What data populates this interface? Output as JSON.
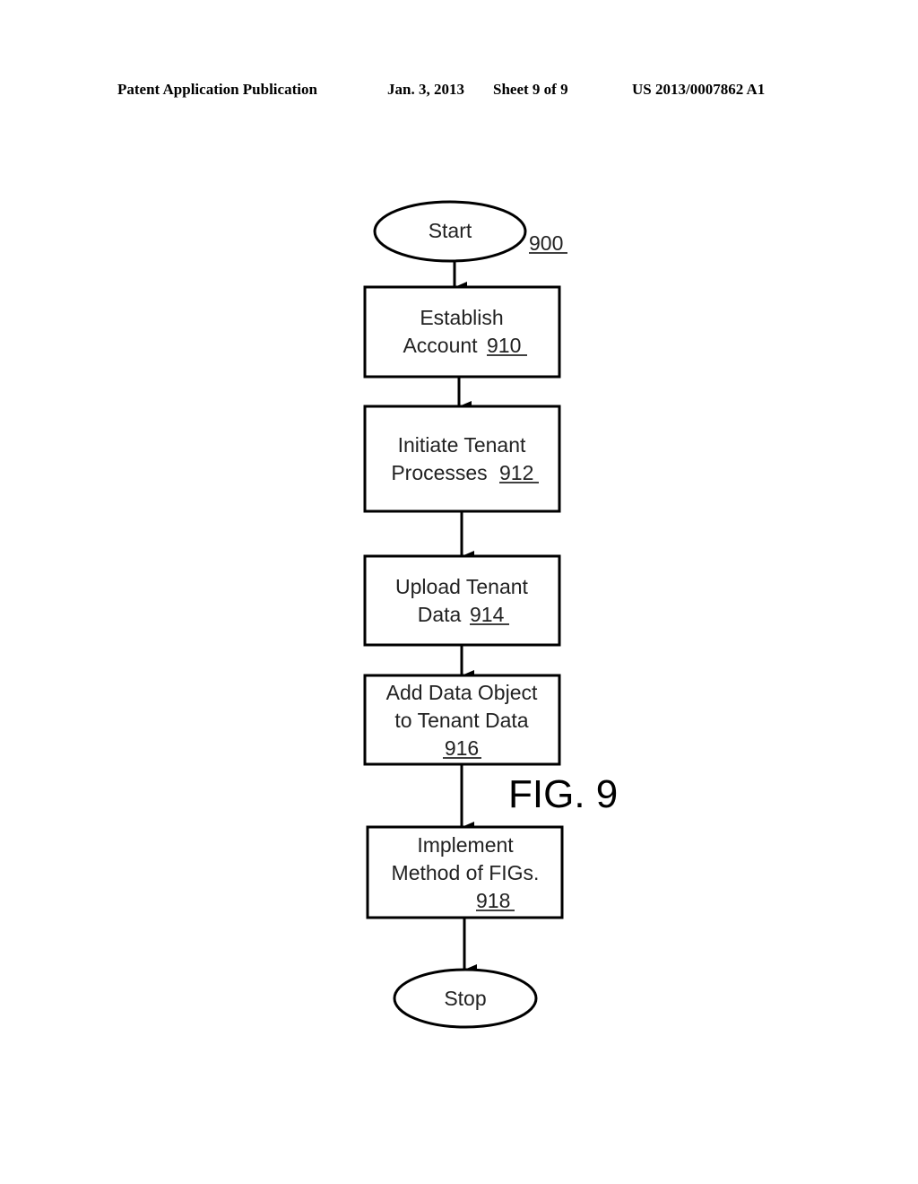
{
  "header": {
    "publication": "Patent Application Publication",
    "date": "Jan. 3, 2013",
    "sheet": "Sheet 9 of 9",
    "number": "US 2013/0007862 A1"
  },
  "figure": {
    "label": "FIG. 9",
    "ref": "900",
    "start": "Start",
    "stop": "Stop",
    "steps": [
      {
        "lines": [
          "Establish",
          "Account"
        ],
        "ref": "910"
      },
      {
        "lines": [
          "Initiate Tenant",
          "Processes"
        ],
        "ref": "912"
      },
      {
        "lines": [
          "Upload Tenant",
          "Data"
        ],
        "ref": "914"
      },
      {
        "lines": [
          "Add Data Object",
          "to Tenant Data"
        ],
        "ref": "916"
      },
      {
        "lines": [
          "Implement",
          "Method of FIGs."
        ],
        "ref": "918"
      }
    ]
  }
}
